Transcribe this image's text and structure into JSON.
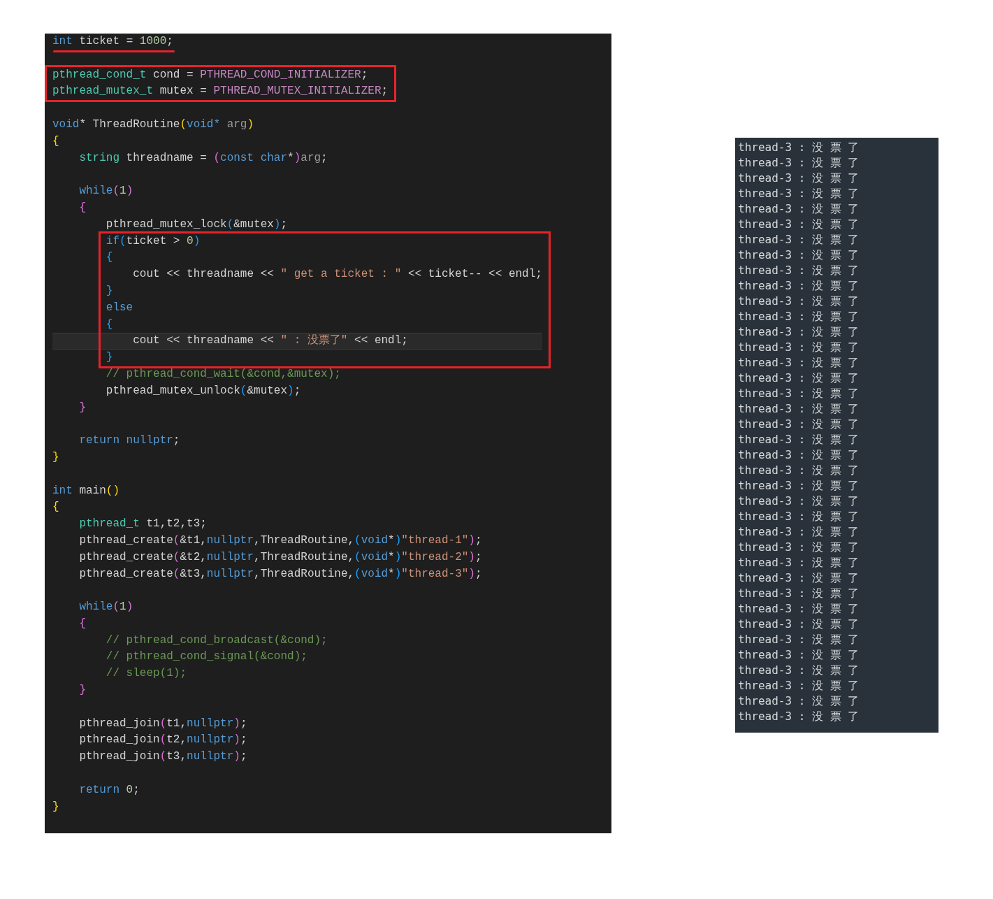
{
  "editor": {
    "blocks": [
      {
        "underlined": true,
        "boxed": false,
        "blank_before": false,
        "lines": [
          {
            "current": false,
            "tokens": [
              {
                "text": "int",
                "kind": "keyword"
              },
              {
                "text": " ticket = ",
                "kind": "plain"
              },
              {
                "text": "1000",
                "kind": "number"
              },
              {
                "text": ";",
                "kind": "plain"
              }
            ]
          }
        ]
      },
      {
        "underlined": false,
        "boxed": true,
        "blank_before": true,
        "lines": [
          {
            "current": false,
            "tokens": [
              {
                "text": "pthread_cond_t",
                "kind": "type"
              },
              {
                "text": " cond = ",
                "kind": "plain"
              },
              {
                "text": "PTHREAD_COND_INITIALIZER",
                "kind": "macro"
              },
              {
                "text": ";",
                "kind": "plain"
              }
            ]
          },
          {
            "current": false,
            "tokens": [
              {
                "text": "pthread_mutex_t",
                "kind": "type"
              },
              {
                "text": " mutex = ",
                "kind": "plain"
              },
              {
                "text": "PTHREAD_MUTEX_INITIALIZER",
                "kind": "macro"
              },
              {
                "text": ";",
                "kind": "plain"
              }
            ]
          }
        ]
      },
      {
        "underlined": false,
        "boxed": false,
        "blank_before": true,
        "lines": [
          {
            "current": false,
            "tokens": [
              {
                "text": "void",
                "kind": "keyword"
              },
              {
                "text": "* ThreadRoutine",
                "kind": "plain"
              },
              {
                "text": "(",
                "kind": "bracket1"
              },
              {
                "text": "void",
                "kind": "keyword"
              },
              {
                "text": "* ",
                "kind": "keyword"
              },
              {
                "text": "arg",
                "kind": "param"
              },
              {
                "text": ")",
                "kind": "bracket1"
              }
            ]
          },
          {
            "current": false,
            "tokens": [
              {
                "text": "{",
                "kind": "bracket1"
              }
            ]
          },
          {
            "current": false,
            "tokens": [
              {
                "text": "    string",
                "kind": "type"
              },
              {
                "text": " threadname = ",
                "kind": "plain"
              },
              {
                "text": "(",
                "kind": "bracket2"
              },
              {
                "text": "const char",
                "kind": "keyword"
              },
              {
                "text": "*",
                "kind": "plain"
              },
              {
                "text": ")",
                "kind": "bracket2"
              },
              {
                "text": "arg",
                "kind": "param"
              },
              {
                "text": ";",
                "kind": "plain"
              }
            ]
          }
        ]
      },
      {
        "underlined": false,
        "boxed": false,
        "blank_before": true,
        "lines": [
          {
            "current": false,
            "tokens": [
              {
                "text": "    while",
                "kind": "keyword"
              },
              {
                "text": "(",
                "kind": "bracket2"
              },
              {
                "text": "1",
                "kind": "number"
              },
              {
                "text": ")",
                "kind": "bracket2"
              }
            ]
          },
          {
            "current": false,
            "tokens": [
              {
                "text": "    {",
                "kind": "bracket2"
              }
            ]
          },
          {
            "current": false,
            "tokens": [
              {
                "text": "        pthread_mutex_lock",
                "kind": "plain"
              },
              {
                "text": "(",
                "kind": "bracket3"
              },
              {
                "text": "&mutex",
                "kind": "plain"
              },
              {
                "text": ")",
                "kind": "bracket3"
              },
              {
                "text": ";",
                "kind": "plain"
              }
            ]
          }
        ]
      },
      {
        "underlined": false,
        "boxed": true,
        "blank_before": false,
        "lines": [
          {
            "current": false,
            "tokens": [
              {
                "text": "        if",
                "kind": "keyword"
              },
              {
                "text": "(",
                "kind": "bracket3"
              },
              {
                "text": "ticket > ",
                "kind": "plain"
              },
              {
                "text": "0",
                "kind": "number"
              },
              {
                "text": ")",
                "kind": "bracket3"
              }
            ]
          },
          {
            "current": false,
            "tokens": [
              {
                "text": "        {",
                "kind": "bracket3"
              }
            ]
          },
          {
            "current": false,
            "tokens": [
              {
                "text": "            cout << threadname << ",
                "kind": "plain"
              },
              {
                "text": "\" get a ticket : \"",
                "kind": "string"
              },
              {
                "text": " << ticket-- << endl;",
                "kind": "plain"
              }
            ]
          },
          {
            "current": false,
            "tokens": [
              {
                "text": "        }",
                "kind": "bracket3"
              }
            ]
          },
          {
            "current": false,
            "tokens": [
              {
                "text": "        else",
                "kind": "keyword"
              }
            ]
          },
          {
            "current": false,
            "tokens": [
              {
                "text": "        {",
                "kind": "bracket3"
              }
            ]
          },
          {
            "current": true,
            "tokens": [
              {
                "text": "            cout << threadname << ",
                "kind": "plain"
              },
              {
                "text": "\" : 没票了\"",
                "kind": "string"
              },
              {
                "text": " << endl;",
                "kind": "plain"
              }
            ]
          },
          {
            "current": false,
            "tokens": [
              {
                "text": "        }",
                "kind": "bracket3"
              }
            ]
          }
        ]
      },
      {
        "underlined": false,
        "boxed": false,
        "blank_before": false,
        "lines": [
          {
            "current": false,
            "tokens": [
              {
                "text": "        // pthread_cond_wait(&cond,&mutex);",
                "kind": "comment"
              }
            ]
          },
          {
            "current": false,
            "tokens": [
              {
                "text": "        pthread_mutex_unlock",
                "kind": "plain"
              },
              {
                "text": "(",
                "kind": "bracket3"
              },
              {
                "text": "&mutex",
                "kind": "plain"
              },
              {
                "text": ")",
                "kind": "bracket3"
              },
              {
                "text": ";",
                "kind": "plain"
              }
            ]
          },
          {
            "current": false,
            "tokens": [
              {
                "text": "    }",
                "kind": "bracket2"
              }
            ]
          }
        ]
      },
      {
        "underlined": false,
        "boxed": false,
        "blank_before": true,
        "lines": [
          {
            "current": false,
            "tokens": [
              {
                "text": "    return",
                "kind": "keyword"
              },
              {
                "text": " nullptr",
                "kind": "keyword"
              },
              {
                "text": ";",
                "kind": "plain"
              }
            ]
          },
          {
            "current": false,
            "tokens": [
              {
                "text": "}",
                "kind": "bracket1"
              }
            ]
          }
        ]
      },
      {
        "underlined": false,
        "boxed": false,
        "blank_before": true,
        "lines": [
          {
            "current": false,
            "tokens": [
              {
                "text": "int",
                "kind": "keyword"
              },
              {
                "text": " main",
                "kind": "plain"
              },
              {
                "text": "()",
                "kind": "bracket1"
              }
            ]
          },
          {
            "current": false,
            "tokens": [
              {
                "text": "{",
                "kind": "bracket1"
              }
            ]
          },
          {
            "current": false,
            "tokens": [
              {
                "text": "    pthread_t",
                "kind": "type"
              },
              {
                "text": " t1,t2,t3;",
                "kind": "plain"
              }
            ]
          },
          {
            "current": false,
            "tokens": [
              {
                "text": "    pthread_create",
                "kind": "plain"
              },
              {
                "text": "(",
                "kind": "bracket2"
              },
              {
                "text": "&t1,",
                "kind": "plain"
              },
              {
                "text": "nullptr",
                "kind": "keyword"
              },
              {
                "text": ",ThreadRoutine,",
                "kind": "plain"
              },
              {
                "text": "(",
                "kind": "bracket3"
              },
              {
                "text": "void",
                "kind": "keyword"
              },
              {
                "text": "*",
                "kind": "plain"
              },
              {
                "text": ")",
                "kind": "bracket3"
              },
              {
                "text": "\"thread-1\"",
                "kind": "string"
              },
              {
                "text": ")",
                "kind": "bracket2"
              },
              {
                "text": ";",
                "kind": "plain"
              }
            ]
          },
          {
            "current": false,
            "tokens": [
              {
                "text": "    pthread_create",
                "kind": "plain"
              },
              {
                "text": "(",
                "kind": "bracket2"
              },
              {
                "text": "&t2,",
                "kind": "plain"
              },
              {
                "text": "nullptr",
                "kind": "keyword"
              },
              {
                "text": ",ThreadRoutine,",
                "kind": "plain"
              },
              {
                "text": "(",
                "kind": "bracket3"
              },
              {
                "text": "void",
                "kind": "keyword"
              },
              {
                "text": "*",
                "kind": "plain"
              },
              {
                "text": ")",
                "kind": "bracket3"
              },
              {
                "text": "\"thread-2\"",
                "kind": "string"
              },
              {
                "text": ")",
                "kind": "bracket2"
              },
              {
                "text": ";",
                "kind": "plain"
              }
            ]
          },
          {
            "current": false,
            "tokens": [
              {
                "text": "    pthread_create",
                "kind": "plain"
              },
              {
                "text": "(",
                "kind": "bracket2"
              },
              {
                "text": "&t3,",
                "kind": "plain"
              },
              {
                "text": "nullptr",
                "kind": "keyword"
              },
              {
                "text": ",ThreadRoutine,",
                "kind": "plain"
              },
              {
                "text": "(",
                "kind": "bracket3"
              },
              {
                "text": "void",
                "kind": "keyword"
              },
              {
                "text": "*",
                "kind": "plain"
              },
              {
                "text": ")",
                "kind": "bracket3"
              },
              {
                "text": "\"thread-3\"",
                "kind": "string"
              },
              {
                "text": ")",
                "kind": "bracket2"
              },
              {
                "text": ";",
                "kind": "plain"
              }
            ]
          }
        ]
      },
      {
        "underlined": false,
        "boxed": false,
        "blank_before": true,
        "lines": [
          {
            "current": false,
            "tokens": [
              {
                "text": "    while",
                "kind": "keyword"
              },
              {
                "text": "(",
                "kind": "bracket2"
              },
              {
                "text": "1",
                "kind": "number"
              },
              {
                "text": ")",
                "kind": "bracket2"
              }
            ]
          },
          {
            "current": false,
            "tokens": [
              {
                "text": "    {",
                "kind": "bracket2"
              }
            ]
          },
          {
            "current": false,
            "tokens": [
              {
                "text": "        // pthread_cond_broadcast(&cond);",
                "kind": "comment"
              }
            ]
          },
          {
            "current": false,
            "tokens": [
              {
                "text": "        // pthread_cond_signal(&cond);",
                "kind": "comment"
              }
            ]
          },
          {
            "current": false,
            "tokens": [
              {
                "text": "        // sleep(1);",
                "kind": "comment"
              }
            ]
          },
          {
            "current": false,
            "tokens": [
              {
                "text": "    }",
                "kind": "bracket2"
              }
            ]
          }
        ]
      },
      {
        "underlined": false,
        "boxed": false,
        "blank_before": true,
        "lines": [
          {
            "current": false,
            "tokens": [
              {
                "text": "    pthread_join",
                "kind": "plain"
              },
              {
                "text": "(",
                "kind": "bracket2"
              },
              {
                "text": "t1,",
                "kind": "plain"
              },
              {
                "text": "nullptr",
                "kind": "keyword"
              },
              {
                "text": ")",
                "kind": "bracket2"
              },
              {
                "text": ";",
                "kind": "plain"
              }
            ]
          },
          {
            "current": false,
            "tokens": [
              {
                "text": "    pthread_join",
                "kind": "plain"
              },
              {
                "text": "(",
                "kind": "bracket2"
              },
              {
                "text": "t2,",
                "kind": "plain"
              },
              {
                "text": "nullptr",
                "kind": "keyword"
              },
              {
                "text": ")",
                "kind": "bracket2"
              },
              {
                "text": ";",
                "kind": "plain"
              }
            ]
          },
          {
            "current": false,
            "tokens": [
              {
                "text": "    pthread_join",
                "kind": "plain"
              },
              {
                "text": "(",
                "kind": "bracket2"
              },
              {
                "text": "t3,",
                "kind": "plain"
              },
              {
                "text": "nullptr",
                "kind": "keyword"
              },
              {
                "text": ")",
                "kind": "bracket2"
              },
              {
                "text": ";",
                "kind": "plain"
              }
            ]
          }
        ]
      },
      {
        "underlined": false,
        "boxed": false,
        "blank_before": true,
        "lines": [
          {
            "current": false,
            "tokens": [
              {
                "text": "    return",
                "kind": "keyword"
              },
              {
                "text": " 0",
                "kind": "number"
              },
              {
                "text": ";",
                "kind": "plain"
              }
            ]
          },
          {
            "current": false,
            "tokens": [
              {
                "text": "}",
                "kind": "bracket1"
              }
            ]
          }
        ]
      }
    ]
  },
  "terminal": {
    "lines": [
      "thread-3 : 没 票 了",
      "thread-3 : 没 票 了",
      "thread-3 : 没 票 了",
      "thread-3 : 没 票 了",
      "thread-3 : 没 票 了",
      "thread-3 : 没 票 了",
      "thread-3 : 没 票 了",
      "thread-3 : 没 票 了",
      "thread-3 : 没 票 了",
      "thread-3 : 没 票 了",
      "thread-3 : 没 票 了",
      "thread-3 : 没 票 了",
      "thread-3 : 没 票 了",
      "thread-3 : 没 票 了",
      "thread-3 : 没 票 了",
      "thread-3 : 没 票 了",
      "thread-3 : 没 票 了",
      "thread-3 : 没 票 了",
      "thread-3 : 没 票 了",
      "thread-3 : 没 票 了",
      "thread-3 : 没 票 了",
      "thread-3 : 没 票 了",
      "thread-3 : 没 票 了",
      "thread-3 : 没 票 了",
      "thread-3 : 没 票 了",
      "thread-3 : 没 票 了",
      "thread-3 : 没 票 了",
      "thread-3 : 没 票 了",
      "thread-3 : 没 票 了",
      "thread-3 : 没 票 了",
      "thread-3 : 没 票 了",
      "thread-3 : 没 票 了",
      "thread-3 : 没 票 了",
      "thread-3 : 没 票 了",
      "thread-3 : 没 票 了",
      "thread-3 : 没 票 了",
      "thread-3 : 没 票 了",
      "thread-3 : 没 票 了"
    ]
  }
}
